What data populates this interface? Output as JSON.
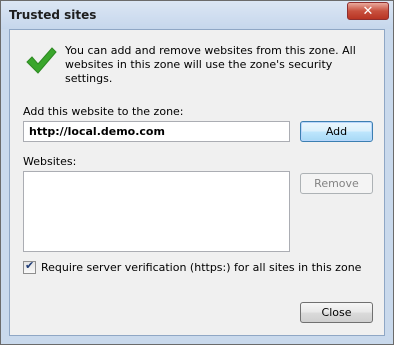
{
  "window": {
    "title": "Trusted sites",
    "close_glyph": "✕"
  },
  "info": {
    "icon": "checkmark-icon",
    "text": "You can add and remove websites from this zone. All websites in this zone will use the zone's security settings."
  },
  "add_section": {
    "label": "Add this website to the zone:",
    "url_value": "http://local.demo.com",
    "add_button": "Add"
  },
  "websites_section": {
    "label": "Websites:",
    "items": [],
    "remove_button": "Remove"
  },
  "https_option": {
    "checked": true,
    "label": "Require server verification (https:) for all sites in this zone"
  },
  "footer": {
    "close_button": "Close"
  },
  "colors": {
    "check_green": "#3aa62c",
    "close_red": "#c8503e"
  }
}
